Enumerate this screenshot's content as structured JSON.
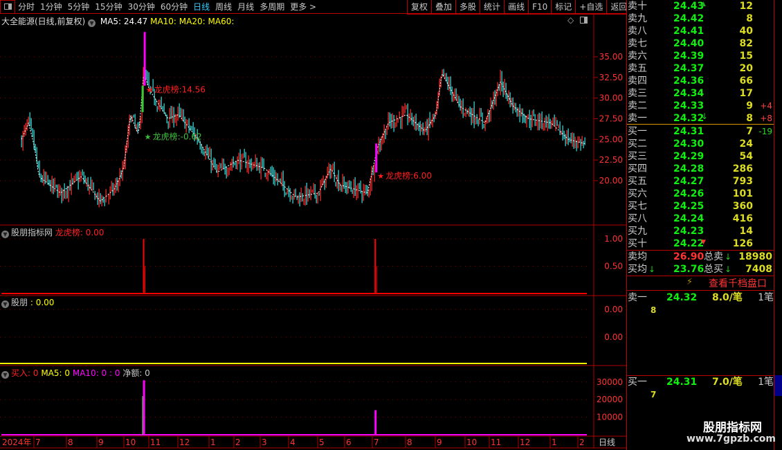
{
  "toolbar": {
    "periods": [
      "分时",
      "1分钟",
      "5分钟",
      "15分钟",
      "30分钟",
      "60分钟",
      "日线",
      "周线",
      "月线",
      "多周期",
      "更多 >"
    ],
    "active": "日线",
    "right_buttons": [
      "复权",
      "叠加",
      "多股",
      "统计",
      "画线",
      "F10",
      "标记",
      "+自选",
      "返回"
    ]
  },
  "main": {
    "title": "大全能源(日线,前复权)",
    "ma5": "MA5: 24.47",
    "ma10": "MA10:",
    "ma20": "MA20:",
    "ma60": "MA60:",
    "price_ticks": [
      "35.00",
      "32.50",
      "30.00",
      "27.50",
      "25.00",
      "22.50",
      "20.00"
    ],
    "annotations": [
      {
        "text": "龙虎榜:14.56",
        "color": "#ff2020"
      },
      {
        "text": "龙虎榜:-0.62",
        "color": "#40c040"
      },
      {
        "text": "龙虎榜:6.00",
        "color": "#ff2020"
      }
    ],
    "price_path": [
      [
        "2024-06-17",
        25
      ],
      [
        "2024-06-24",
        27
      ],
      [
        "2024-07-01",
        24
      ],
      [
        "2024-07-05",
        20.5
      ],
      [
        "2024-07-25",
        18.5
      ],
      [
        "2024-08-15",
        20.5
      ],
      [
        "2024-09-04",
        17.5
      ],
      [
        "2024-09-20",
        19
      ],
      [
        "2024-09-30",
        21.5
      ],
      [
        "2024-10-08",
        28
      ],
      [
        "2024-10-18",
        25.5
      ],
      [
        "2024-10-24",
        33
      ],
      [
        "2024-10-31",
        31
      ],
      [
        "2024-11-20",
        27.5
      ],
      [
        "2024-12-01",
        28
      ],
      [
        "2024-12-20",
        25
      ],
      [
        "2025-01-10",
        21
      ],
      [
        "2025-02-05",
        22.5
      ],
      [
        "2025-03-05",
        21.5
      ],
      [
        "2025-04-08",
        18
      ],
      [
        "2025-05-01",
        18.5
      ],
      [
        "2025-05-15",
        21.5
      ],
      [
        "2025-05-25",
        19.5
      ],
      [
        "2025-06-25",
        18.5
      ],
      [
        "2025-07-05",
        24
      ],
      [
        "2025-07-15",
        27
      ],
      [
        "2025-08-01",
        28
      ],
      [
        "2025-08-20",
        26
      ],
      [
        "2025-09-01",
        28
      ],
      [
        "2025-09-07",
        33
      ],
      [
        "2025-09-25",
        29
      ],
      [
        "2025-10-25",
        27
      ],
      [
        "2025-11-12",
        32
      ],
      [
        "2025-11-25",
        29
      ],
      [
        "2025-12-10",
        27.5
      ],
      [
        "2026-01-01",
        27
      ],
      [
        "2026-01-20",
        25
      ],
      [
        "2026-02-08",
        24.47
      ]
    ]
  },
  "ind1": {
    "name": "股朋指标网",
    "label": "龙虎榜: 0.00",
    "ticks": [
      "1.00",
      "0.50"
    ],
    "spikes": [
      [
        "2024-10-24",
        1
      ],
      [
        "2025-07-03",
        1
      ]
    ]
  },
  "ind2": {
    "name": "股朋",
    "label": ": 0.00",
    "ticks": [
      "0.00",
      "0.00"
    ]
  },
  "ind3": {
    "buy": "买入: 0",
    "ma5": "MA5: 0",
    "ma10": "MA10: 0 : 0",
    "net": "净额: 0",
    "ticks": [
      "30000",
      "20000",
      "10000"
    ],
    "bars": [
      [
        "2024-10-23",
        22000,
        "#40d040"
      ],
      [
        "2024-10-24",
        31000,
        "#ff00ff"
      ],
      [
        "2025-07-03",
        14000,
        "#ff00ff"
      ]
    ]
  },
  "date_axis": {
    "labels": [
      "2024年",
      "7",
      "8",
      "9",
      "10",
      "11",
      "12",
      "1",
      "2",
      "3",
      "4",
      "5",
      "6",
      "7",
      "8",
      "9",
      "10",
      "11",
      "12",
      "1",
      "2"
    ],
    "period": "日线"
  },
  "orderbook": {
    "asks": [
      [
        "卖十",
        "24.43",
        "12",
        ""
      ],
      [
        "卖九",
        "24.42",
        "8",
        ""
      ],
      [
        "卖八",
        "24.41",
        "40",
        ""
      ],
      [
        "卖七",
        "24.40",
        "82",
        ""
      ],
      [
        "卖六",
        "24.39",
        "15",
        ""
      ],
      [
        "卖五",
        "24.37",
        "20",
        ""
      ],
      [
        "卖四",
        "24.36",
        "66",
        ""
      ],
      [
        "卖三",
        "24.34",
        "17",
        ""
      ],
      [
        "卖二",
        "24.33",
        "9",
        "+4"
      ],
      [
        "卖一",
        "24.32",
        "8",
        "+8"
      ]
    ],
    "bids": [
      [
        "买一",
        "24.31",
        "7",
        "-19"
      ],
      [
        "买二",
        "24.30",
        "24",
        ""
      ],
      [
        "买三",
        "24.29",
        "54",
        ""
      ],
      [
        "买四",
        "24.28",
        "286",
        ""
      ],
      [
        "买五",
        "24.27",
        "793",
        ""
      ],
      [
        "买六",
        "24.26",
        "101",
        ""
      ],
      [
        "买七",
        "24.25",
        "360",
        ""
      ],
      [
        "买八",
        "24.24",
        "416",
        ""
      ],
      [
        "买九",
        "24.23",
        "14",
        ""
      ],
      [
        "买十",
        "24.22",
        "126",
        ""
      ]
    ],
    "avg_sell_label": "卖均",
    "avg_sell": "26.90",
    "total_sell_label": "总卖",
    "total_sell": "18980",
    "avg_buy_label": "买均",
    "avg_buy": "23.76",
    "total_buy_label": "总买",
    "total_buy": "7408",
    "depth_link": "查看千档盘口",
    "sell1": {
      "label": "卖一",
      "price": "24.32",
      "per": "8.0/笔",
      "count": "1笔",
      "qty": "8"
    },
    "buy1": {
      "label": "买一",
      "price": "24.31",
      "per": "7.0/笔",
      "count": "1笔",
      "qty": "7"
    }
  },
  "watermark": {
    "name": "股朋指标网",
    "url": "www.7gpzb.com"
  },
  "colors": {
    "up": "#ff3030",
    "down": "#40e0e0",
    "grid": "#b00000",
    "ma": "#ffffff"
  }
}
